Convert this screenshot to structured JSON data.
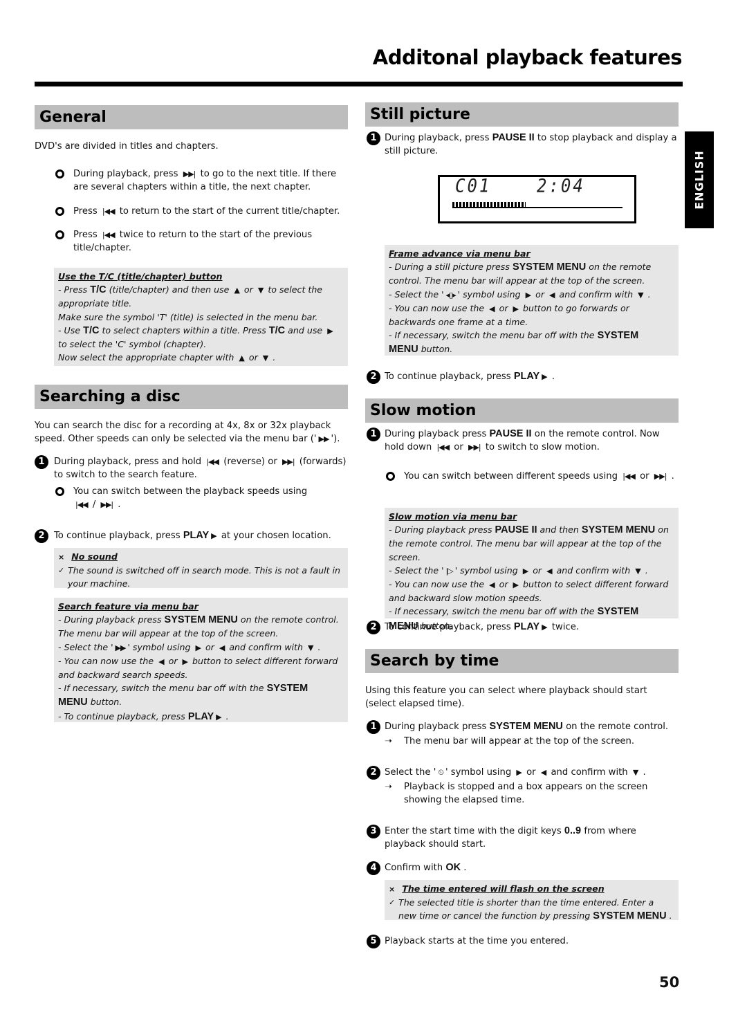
{
  "page": {
    "title": "Additonal playback features",
    "language_tab": "ENGLISH",
    "page_number": "50"
  },
  "icons": {
    "next": "▶▶|",
    "prev": "|◀◀",
    "play": "▶",
    "right": "▶",
    "left": "◀",
    "up": "▲",
    "down": "▼",
    "fast_forward": "▶▶",
    "frame": "◂▯▸",
    "slow": "|▷",
    "clock": "⏲",
    "arrow": "➝",
    "cross": "×",
    "check": "✓"
  },
  "general": {
    "heading": "General",
    "intro": "DVD's are divided in titles and chapters.",
    "bullets": [
      {
        "pre": "During playback, press",
        "post": "to go to the next title. If there are several chapters within a title, the next chapter."
      },
      {
        "pre": "Press",
        "post": "to return to the start of the current title/chapter."
      },
      {
        "pre": "Press",
        "post": "twice to return to the start of the previous title/chapter."
      }
    ],
    "note": {
      "title": "Use the  T/C (title/chapter) button",
      "key_tc": "T/C",
      "l1a": "- Press",
      "l1b": "(title/chapter) and then use",
      "or": "or",
      "l1c": "to select the appropriate title.",
      "l2": "Make sure the symbol 'T' (title) is selected in the menu bar.",
      "l3a": "- Use",
      "l3b": "to select chapters within a title. Press",
      "l3c": "and use",
      "l3d": "to select the 'C' symbol (chapter).",
      "l4": "Now select the appropriate chapter with"
    }
  },
  "searching": {
    "heading": "Searching a disc",
    "intro_a": "You can search the disc for a recording at 4x, 8x or 32x playback speed. Other speeds can only be selected via the menu bar ('",
    "intro_b": "').",
    "step1": {
      "num": "1",
      "a": "During playback, press and hold",
      "b": "(reverse) or",
      "c": "(forwards) to switch to the search feature."
    },
    "bullet": {
      "text": "You can switch between the playback speeds using",
      "sep": "/"
    },
    "step2": {
      "num": "2",
      "a": "To continue playback, press",
      "key": "PLAY",
      "b": "at your chosen location."
    },
    "trouble": {
      "title": "No sound",
      "text": "The sound is switched off in search mode. This is not a fault in your machine."
    },
    "note": {
      "title": "Search feature via menu bar",
      "l1a": "- During playback press",
      "key_sys": "SYSTEM MENU",
      "l1b": "on the remote control. The menu bar will appear at the top of the screen.",
      "l2a": "- Select the '",
      "l2b": "' symbol using",
      "or": "or",
      "l2c": "and confirm with",
      "l3a": "- You can now use the",
      "l3b": "button to select different forward and backward search speeds.",
      "l4a": "- If necessary, switch the menu bar off with the",
      "key_system": "SYSTEM",
      "key_menu": "MENU",
      "l4b": "button.",
      "l5a": "- To continue playback, press",
      "key_play": "PLAY"
    }
  },
  "still": {
    "heading": "Still picture",
    "step1": {
      "num": "1",
      "a": "During playback, press",
      "key": "PAUSE II",
      "b": "to stop playback and display a still picture."
    },
    "display": {
      "chapter": "C01",
      "time": "2:04",
      "progress_percent": 43
    },
    "note": {
      "title": "Frame advance via menu bar",
      "l1a": "- During a still picture press",
      "key_sys": "SYSTEM MENU",
      "l1b": "on the remote control. The menu bar will appear at the top of the screen.",
      "l2a": "- Select the '",
      "l2b": "' symbol using",
      "or": "or",
      "l2c": "and confirm with",
      "l3a": "- You can now use the",
      "l3b": "button to go forwards or backwards one frame at a time.",
      "l4a": "- If necessary, switch the menu bar off with the",
      "key_system": "SYSTEM",
      "key_menu": "MENU",
      "l4b": "button."
    },
    "step2": {
      "num": "2",
      "a": "To continue playback, press",
      "key": "PLAY"
    }
  },
  "slow": {
    "heading": "Slow motion",
    "step1": {
      "num": "1",
      "a": "During playback press",
      "key": "PAUSE II",
      "b": "on the remote control. Now hold down",
      "or": "or",
      "c": "to switch to slow motion."
    },
    "bullet": {
      "text": "You can switch between different speeds using",
      "or": "or"
    },
    "note": {
      "title": "Slow motion via menu bar",
      "l1a": "- During playback press",
      "key_pause": "PAUSE II",
      "l1b": "and then",
      "key_sys": "SYSTEM MENU",
      "l1c": "on the remote control. The menu bar will appear at the top of the screen.",
      "l2a": "- Select the '",
      "l2b": "' symbol using",
      "or": "or",
      "l2c": "and confirm with",
      "l3a": "- You can now use the",
      "l3b": "button to select different forward and backward slow motion speeds.",
      "l4a": "- If necessary, switch the menu bar off with the",
      "key_system": "SYSTEM",
      "key_menu": "MENU",
      "l4b": "button."
    },
    "step2": {
      "num": "2",
      "a": "To continue playback, press",
      "key": "PLAY",
      "b": "twice."
    }
  },
  "search_time": {
    "heading": "Search by time",
    "intro": "Using this feature you can select where playback should start (select elapsed time).",
    "step1": {
      "num": "1",
      "a": "During playback press",
      "key": "SYSTEM MENU",
      "b": "on the remote control.",
      "result": "The menu bar will appear at the top of the screen."
    },
    "step2": {
      "num": "2",
      "a": "Select the '",
      "b": "' symbol using",
      "or": "or",
      "c": "and confirm with",
      "result": "Playback is stopped and a box appears on the screen showing the elapsed time."
    },
    "step3": {
      "num": "3",
      "a": "Enter the start time with the digit keys",
      "key": "0..9",
      "b": "from where playback should start."
    },
    "step4": {
      "num": "4",
      "a": "Confirm with",
      "key": "OK"
    },
    "trouble": {
      "title": "The time entered will flash on the screen",
      "text": "The selected title is shorter than the time entered. Enter a new time or cancel the function by pressing",
      "key": "SYSTEM MENU"
    },
    "step5": {
      "num": "5",
      "a": "Playback starts at the time you entered."
    }
  }
}
